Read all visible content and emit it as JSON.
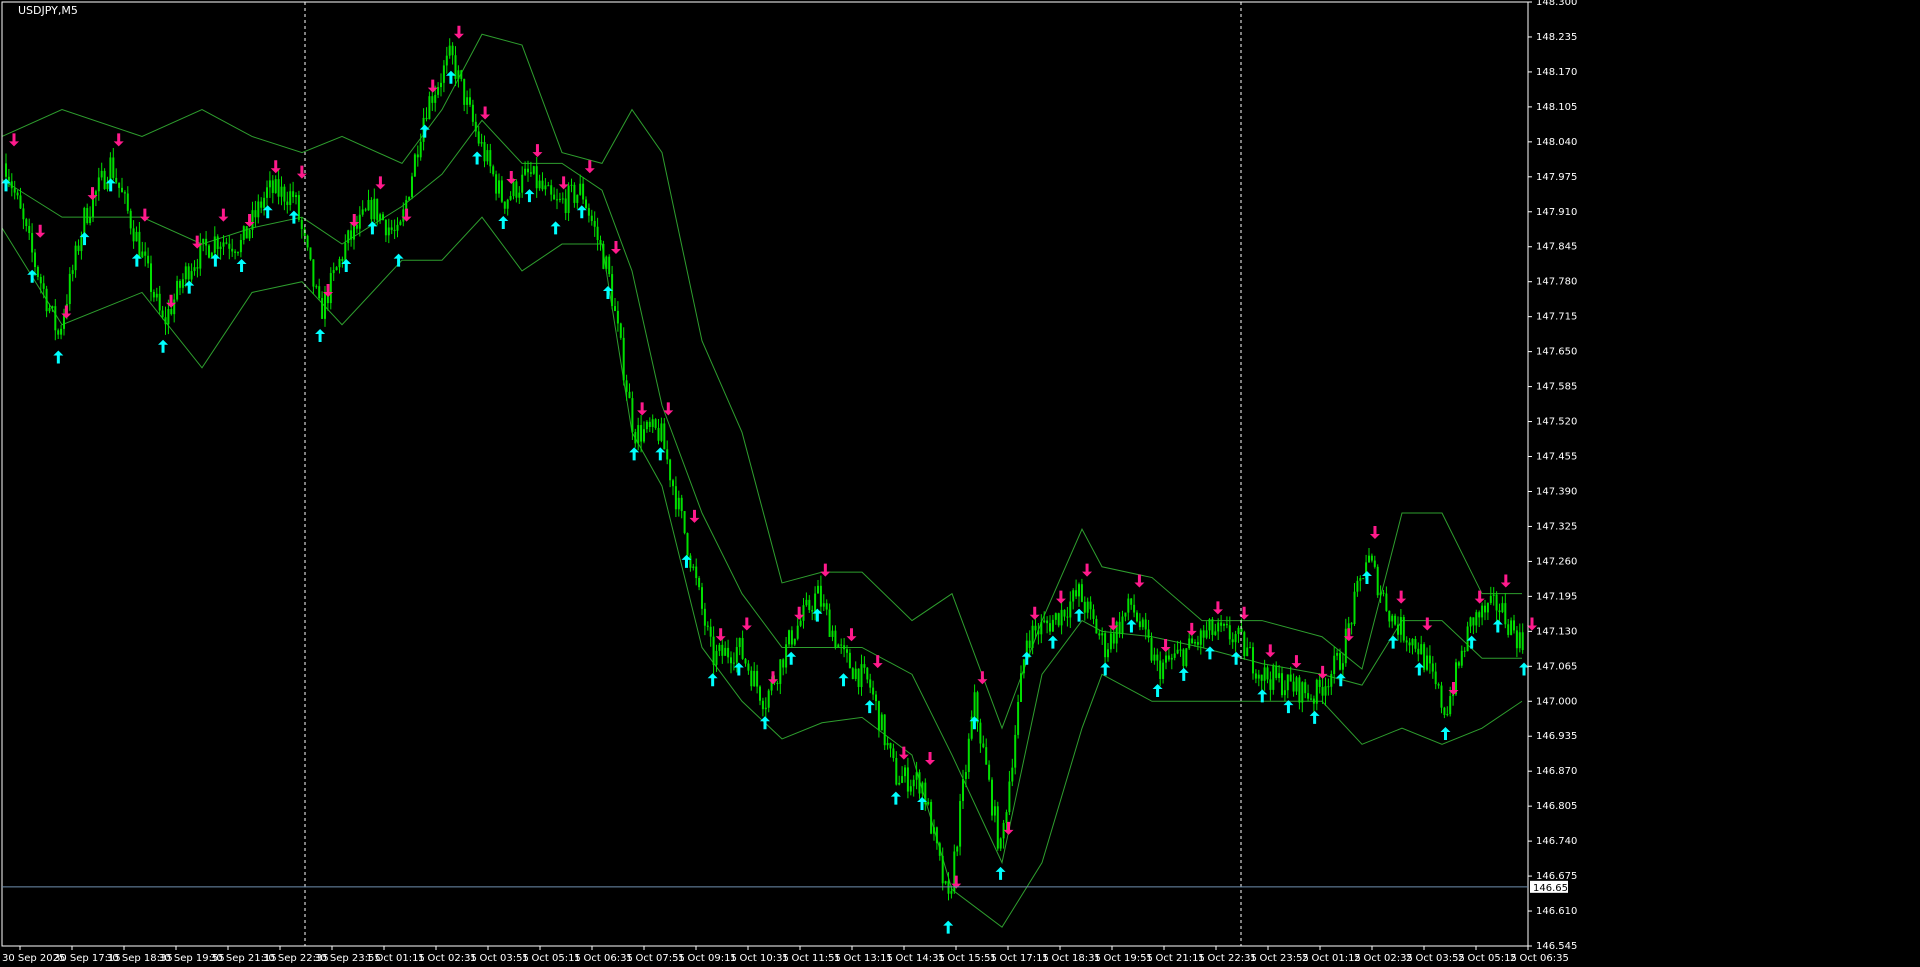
{
  "chart_data": {
    "type": "candlestick",
    "title": "USDJPY,M5",
    "symbol": "USDJPY",
    "timeframe": "M5",
    "ylim": [
      146.545,
      148.3
    ],
    "y_ticks": [
      "148.300",
      "148.235",
      "148.170",
      "148.105",
      "148.040",
      "147.975",
      "147.910",
      "147.845",
      "147.780",
      "147.715",
      "147.650",
      "147.585",
      "147.520",
      "147.455",
      "147.390",
      "147.325",
      "147.260",
      "147.195",
      "147.130",
      "147.065",
      "147.000",
      "146.935",
      "146.870",
      "146.805",
      "146.740",
      "146.675",
      "146.610",
      "146.545"
    ],
    "x_ticks": [
      "30 Sep 2025",
      "30 Sep 17:15",
      "30 Sep 18:35",
      "30 Sep 19:55",
      "30 Sep 21:15",
      "30 Sep 22:35",
      "30 Sep 23:55",
      "1 Oct 01:15",
      "1 Oct 02:35",
      "1 Oct 03:55",
      "1 Oct 05:15",
      "1 Oct 06:35",
      "1 Oct 07:55",
      "1 Oct 09:15",
      "1 Oct 10:35",
      "1 Oct 11:55",
      "1 Oct 13:15",
      "1 Oct 14:35",
      "1 Oct 15:55",
      "1 Oct 17:15",
      "1 Oct 18:35",
      "1 Oct 19:55",
      "1 Oct 21:15",
      "1 Oct 22:35",
      "1 Oct 23:55",
      "2 Oct 01:15",
      "2 Oct 02:35",
      "2 Oct 03:55",
      "2 Oct 05:15",
      "2 Oct 06:35"
    ],
    "current_price": "146.655",
    "grid": false,
    "colors": {
      "background": "#000000",
      "candle": "#00e000",
      "bands": "#2e9e2e",
      "buy_arrow": "#00ffff",
      "sell_arrow": "#ff1a8c",
      "axis": "#ffffff",
      "price_line": "#6f8faf",
      "separator": "#ffffff"
    },
    "session_separators": [
      "30 Sep 23:55",
      "1 Oct 23:55"
    ],
    "close_path": [
      [
        "30 Sep 2025",
        148.0
      ],
      [
        "30 Sep 16:30",
        147.83
      ],
      [
        "30 Sep 17:15",
        147.68
      ],
      [
        "30 Sep 17:45",
        147.9
      ],
      [
        "30 Sep 18:35",
        148.0
      ],
      [
        "30 Sep 19:15",
        147.86
      ],
      [
        "30 Sep 19:55",
        147.7
      ],
      [
        "30 Sep 20:30",
        147.81
      ],
      [
        "30 Sep 21:15",
        147.86
      ],
      [
        "30 Sep 21:55",
        147.85
      ],
      [
        "30 Sep 22:35",
        147.95
      ],
      [
        "30 Sep 23:15",
        147.94
      ],
      [
        "30 Sep 23:55",
        147.72
      ],
      [
        "1 Oct 00:35",
        147.85
      ],
      [
        "1 Oct 01:15",
        147.92
      ],
      [
        "1 Oct 01:55",
        147.86
      ],
      [
        "1 Oct 02:35",
        148.1
      ],
      [
        "1 Oct 03:15",
        148.2
      ],
      [
        "1 Oct 03:55",
        148.05
      ],
      [
        "1 Oct 04:35",
        147.93
      ],
      [
        "1 Oct 05:15",
        147.98
      ],
      [
        "1 Oct 05:55",
        147.92
      ],
      [
        "1 Oct 06:35",
        147.95
      ],
      [
        "1 Oct 07:15",
        147.8
      ],
      [
        "1 Oct 07:55",
        147.5
      ],
      [
        "1 Oct 08:35",
        147.5
      ],
      [
        "1 Oct 09:15",
        147.3
      ],
      [
        "1 Oct 09:55",
        147.08
      ],
      [
        "1 Oct 10:35",
        147.1
      ],
      [
        "1 Oct 11:15",
        147.0
      ],
      [
        "1 Oct 11:55",
        147.12
      ],
      [
        "1 Oct 12:35",
        147.2
      ],
      [
        "1 Oct 13:15",
        147.08
      ],
      [
        "1 Oct 13:55",
        147.03
      ],
      [
        "1 Oct 14:35",
        146.86
      ],
      [
        "1 Oct 15:15",
        146.85
      ],
      [
        "1 Oct 15:55",
        146.62
      ],
      [
        "1 Oct 16:35",
        147.0
      ],
      [
        "1 Oct 17:15",
        146.72
      ],
      [
        "1 Oct 17:55",
        147.12
      ],
      [
        "1 Oct 18:35",
        147.15
      ],
      [
        "1 Oct 19:15",
        147.2
      ],
      [
        "1 Oct 19:55",
        147.1
      ],
      [
        "1 Oct 20:35",
        147.18
      ],
      [
        "1 Oct 21:15",
        147.06
      ],
      [
        "1 Oct 21:55",
        147.09
      ],
      [
        "1 Oct 22:35",
        147.13
      ],
      [
        "1 Oct 23:15",
        147.12
      ],
      [
        "1 Oct 23:55",
        147.05
      ],
      [
        "2 Oct 00:35",
        147.03
      ],
      [
        "2 Oct 01:15",
        147.01
      ],
      [
        "2 Oct 01:55",
        147.08
      ],
      [
        "2 Oct 02:35",
        147.27
      ],
      [
        "2 Oct 03:15",
        147.15
      ],
      [
        "2 Oct 03:55",
        147.1
      ],
      [
        "2 Oct 04:35",
        146.98
      ],
      [
        "2 Oct 05:15",
        147.15
      ],
      [
        "2 Oct 05:55",
        147.18
      ],
      [
        "2 Oct 06:35",
        147.1
      ]
    ],
    "bollinger_bands": {
      "upper": [
        [
          0,
          148.05
        ],
        [
          60,
          148.1
        ],
        [
          140,
          148.05
        ],
        [
          200,
          148.1
        ],
        [
          250,
          148.05
        ],
        [
          300,
          148.02
        ],
        [
          340,
          148.05
        ],
        [
          400,
          148.0
        ],
        [
          440,
          148.1
        ],
        [
          480,
          148.24
        ],
        [
          520,
          148.22
        ],
        [
          560,
          148.02
        ],
        [
          600,
          148.0
        ],
        [
          630,
          148.1
        ],
        [
          660,
          148.02
        ],
        [
          700,
          147.67
        ],
        [
          740,
          147.5
        ],
        [
          780,
          147.22
        ],
        [
          820,
          147.24
        ],
        [
          860,
          147.24
        ],
        [
          910,
          147.15
        ],
        [
          950,
          147.2
        ],
        [
          1000,
          146.95
        ],
        [
          1040,
          147.15
        ],
        [
          1080,
          147.32
        ],
        [
          1100,
          147.25
        ],
        [
          1150,
          147.23
        ],
        [
          1200,
          147.15
        ],
        [
          1260,
          147.15
        ],
        [
          1320,
          147.12
        ],
        [
          1360,
          147.06
        ],
        [
          1400,
          147.35
        ],
        [
          1440,
          147.35
        ],
        [
          1480,
          147.2
        ],
        [
          1520,
          147.2
        ]
      ],
      "middle": [
        [
          0,
          147.97
        ],
        [
          60,
          147.9
        ],
        [
          140,
          147.9
        ],
        [
          200,
          147.85
        ],
        [
          250,
          147.88
        ],
        [
          300,
          147.9
        ],
        [
          340,
          147.85
        ],
        [
          400,
          147.92
        ],
        [
          440,
          147.98
        ],
        [
          480,
          148.08
        ],
        [
          520,
          148.0
        ],
        [
          560,
          148.0
        ],
        [
          600,
          147.95
        ],
        [
          630,
          147.8
        ],
        [
          660,
          147.55
        ],
        [
          700,
          147.35
        ],
        [
          740,
          147.2
        ],
        [
          780,
          147.1
        ],
        [
          820,
          147.1
        ],
        [
          860,
          147.1
        ],
        [
          910,
          147.05
        ],
        [
          950,
          146.9
        ],
        [
          1000,
          146.7
        ],
        [
          1040,
          147.05
        ],
        [
          1080,
          147.15
        ],
        [
          1100,
          147.13
        ],
        [
          1150,
          147.12
        ],
        [
          1200,
          147.1
        ],
        [
          1260,
          147.07
        ],
        [
          1320,
          147.05
        ],
        [
          1360,
          147.03
        ],
        [
          1400,
          147.15
        ],
        [
          1440,
          147.15
        ],
        [
          1480,
          147.08
        ],
        [
          1520,
          147.08
        ]
      ],
      "lower": [
        [
          0,
          147.88
        ],
        [
          60,
          147.7
        ],
        [
          140,
          147.76
        ],
        [
          200,
          147.62
        ],
        [
          250,
          147.76
        ],
        [
          300,
          147.78
        ],
        [
          340,
          147.7
        ],
        [
          400,
          147.82
        ],
        [
          440,
          147.82
        ],
        [
          480,
          147.9
        ],
        [
          520,
          147.8
        ],
        [
          560,
          147.85
        ],
        [
          600,
          147.85
        ],
        [
          630,
          147.5
        ],
        [
          660,
          147.4
        ],
        [
          700,
          147.1
        ],
        [
          740,
          147.0
        ],
        [
          780,
          146.93
        ],
        [
          820,
          146.96
        ],
        [
          860,
          146.97
        ],
        [
          910,
          146.9
        ],
        [
          950,
          146.65
        ],
        [
          1000,
          146.58
        ],
        [
          1040,
          146.7
        ],
        [
          1080,
          146.95
        ],
        [
          1100,
          147.05
        ],
        [
          1150,
          147.0
        ],
        [
          1200,
          147.0
        ],
        [
          1260,
          147.0
        ],
        [
          1320,
          147.0
        ],
        [
          1360,
          146.92
        ],
        [
          1400,
          146.95
        ],
        [
          1440,
          146.92
        ],
        [
          1480,
          146.95
        ],
        [
          1520,
          147.0
        ]
      ]
    },
    "series": [
      {
        "name": "Buy signals",
        "count": 58
      },
      {
        "name": "Sell signals",
        "count": 62
      }
    ]
  }
}
